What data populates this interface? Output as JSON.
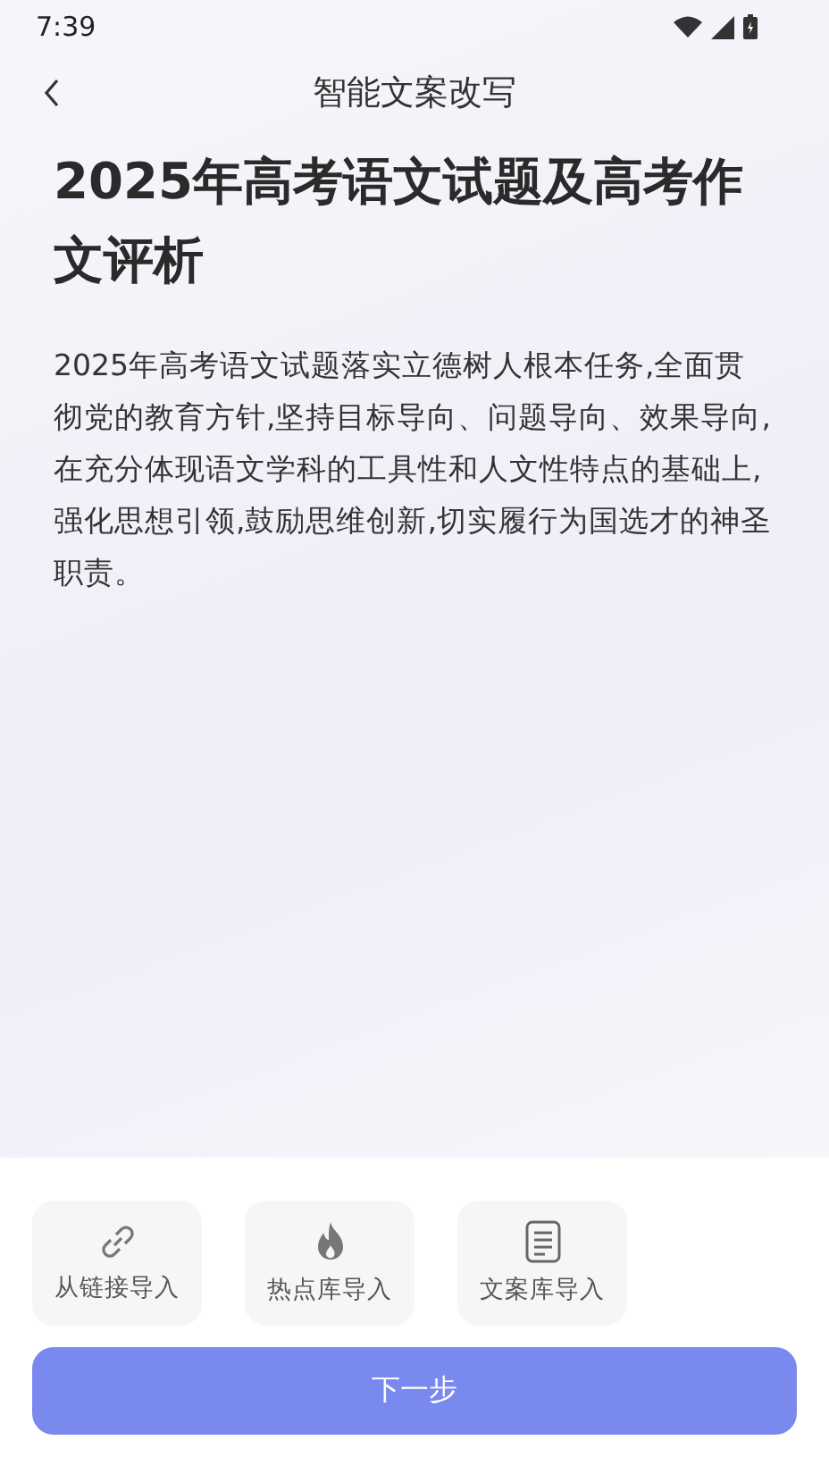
{
  "status_bar": {
    "time": "7:39"
  },
  "header": {
    "title": "智能文案改写"
  },
  "article": {
    "title": "2025年高考语文试题及高考作文评析",
    "body": "2025年高考语文试题落实立德树人根本任务,全面贯彻党的教育方针,坚持目标导向、问题导向、效果导向,在充分体现语文学科的工具性和人文性特点的基础上,强化思想引领,鼓励思维创新,切实履行为国选才的神圣职责。"
  },
  "import_options": [
    {
      "kind": "link",
      "label": "从链接导入"
    },
    {
      "kind": "fire",
      "label": "热点库导入"
    },
    {
      "kind": "document",
      "label": "文案库导入"
    }
  ],
  "next_button": {
    "label": "下一步"
  }
}
